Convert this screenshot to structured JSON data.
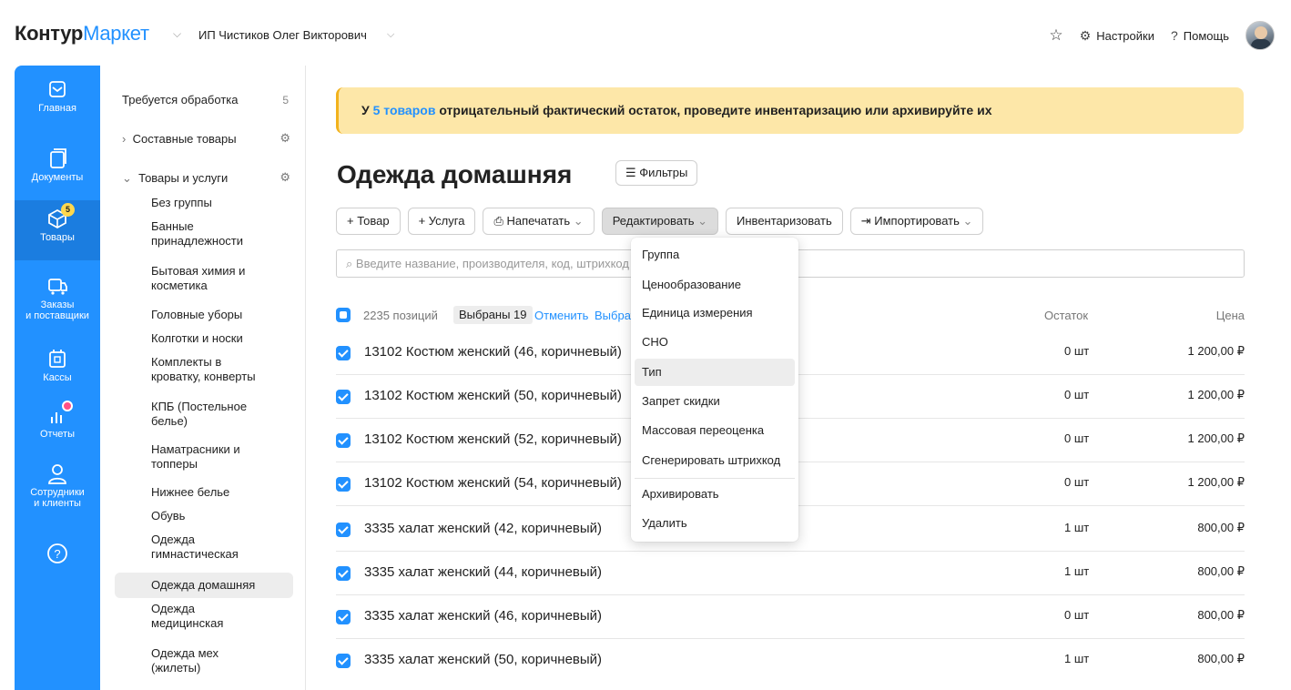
{
  "header": {
    "logo_bold": "Контур",
    "logo_light": "Маркет",
    "org": "ИП Чистиков Олег Викторович",
    "settings": "Настройки",
    "help": "Помощь"
  },
  "sidebar": {
    "items": [
      {
        "label": "Главная",
        "icon": "mail-icon"
      },
      {
        "label": "Документы",
        "icon": "document-icon"
      },
      {
        "label": "Товары",
        "icon": "box-icon",
        "badge": "5"
      },
      {
        "label_1": "Заказы",
        "label_2": "и поставщики",
        "icon": "truck-icon"
      },
      {
        "label": "Кассы",
        "icon": "cash-register-icon"
      },
      {
        "label": "Отчеты",
        "icon": "chart-icon"
      },
      {
        "label_1": "Сотрудники",
        "label_2": "и клиенты",
        "icon": "person-icon"
      }
    ]
  },
  "tree": {
    "needs_processing": "Требуется обработка",
    "needs_processing_count": "5",
    "composite": "Составные товары",
    "goods_services": "Товары и услуги",
    "groups": [
      {
        "l1": "Без группы",
        "l2": ""
      },
      {
        "l1": "Банные",
        "l2": "принадлежности"
      },
      {
        "l1": "Бытовая химия и",
        "l2": "косметика"
      },
      {
        "l1": "Головные уборы",
        "l2": ""
      },
      {
        "l1": "Колготки и носки",
        "l2": ""
      },
      {
        "l1": "Комплекты в",
        "l2": "кроватку, конверты"
      },
      {
        "l1": "КПБ (Постельное",
        "l2": "белье)"
      },
      {
        "l1": "Наматрасники и",
        "l2": "топперы"
      },
      {
        "l1": "Нижнее белье",
        "l2": ""
      },
      {
        "l1": "Обувь",
        "l2": ""
      },
      {
        "l1": "Одежда",
        "l2": "гимнастическая"
      },
      {
        "l1": "Одежда домашняя",
        "l2": ""
      },
      {
        "l1": "Одежда",
        "l2": "медицинская"
      },
      {
        "l1": "Одежда мех",
        "l2": "(жилеты)"
      }
    ]
  },
  "banner": {
    "prefix": "У ",
    "link": "5 товаров",
    "suffix": " отрицательный фактический остаток, проведите инвентаризацию или архивируйте их"
  },
  "page": {
    "title": "Одежда домашняя",
    "filters": "Фильтры"
  },
  "toolbar": {
    "add_goods": "+ Товар",
    "add_service": "+ Услуга",
    "print": "Напечатать",
    "edit": "Редактировать",
    "inventory": "Инвентаризовать",
    "import": "Импортировать"
  },
  "search": {
    "placeholder": "Введите название, производителя, код, штрихкод"
  },
  "list": {
    "count": "2235 позиций",
    "selected": "Выбраны 19",
    "cancel": "Отменить",
    "choose_all": "Выбрать",
    "col_stock": "Остаток",
    "col_price": "Цена",
    "rows": [
      {
        "name": "13102 Костюм женский (46, коричневый)",
        "qty": "0 шт",
        "price": "1 200,00 ₽"
      },
      {
        "name": "13102 Костюм женский (50, коричневый)",
        "qty": "0 шт",
        "price": "1 200,00 ₽"
      },
      {
        "name": "13102 Костюм женский (52, коричневый)",
        "qty": "0 шт",
        "price": "1 200,00 ₽"
      },
      {
        "name": "13102 Костюм женский (54, коричневый)",
        "qty": "0 шт",
        "price": "1 200,00 ₽"
      },
      {
        "name": "3335 халат женский (42, коричневый)",
        "qty": "1 шт",
        "price": "800,00 ₽"
      },
      {
        "name": "3335 халат женский (44, коричневый)",
        "qty": "1 шт",
        "price": "800,00 ₽"
      },
      {
        "name": "3335 халат женский (46, коричневый)",
        "qty": "0 шт",
        "price": "800,00 ₽"
      },
      {
        "name": "3335 халат женский (50, коричневый)",
        "qty": "1 шт",
        "price": "800,00 ₽"
      }
    ]
  },
  "edit_menu": {
    "items": [
      "Группа",
      "Ценообразование",
      "Единица измерения",
      "СНО",
      "Тип",
      "Запрет скидки",
      "Массовая переоценка",
      "Сгенерировать штрихкод",
      "Архивировать",
      "Удалить"
    ],
    "hovered": "Тип"
  },
  "colors": {
    "accent": "#2291ff",
    "banner": "#fde7a8",
    "badge": "#ffd84d",
    "notify": "#ff4f86"
  }
}
